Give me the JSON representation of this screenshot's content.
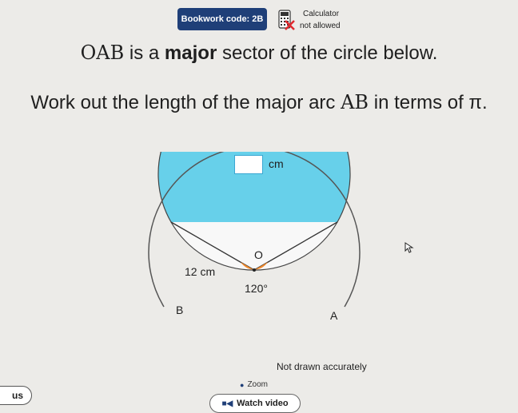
{
  "header": {
    "bookwork_label": "Bookwork code: 2B",
    "calculator_line1": "Calculator",
    "calculator_line2": "not allowed"
  },
  "question": {
    "line1_math": "OAB",
    "line1_part1": " is a ",
    "line1_bold": "major",
    "line1_part2": " sector of the circle below.",
    "line2_part1": "Work out the length of the major arc ",
    "line2_math": "AB",
    "line2_part2": " in terms of π."
  },
  "diagram": {
    "answer_unit": "cm",
    "radius_label": "12 cm",
    "angle_label": "120°",
    "label_O": "O",
    "label_A": "A",
    "label_B": "B",
    "note": "Not drawn accurately"
  },
  "controls": {
    "zoom_label": "Zoom",
    "left_button_label": "us",
    "watch_video_label": "Watch video"
  },
  "colors": {
    "sector_fill": "#67d0ea",
    "angle_fill": "#f08a2e",
    "bookwork_bg": "#1f3f78",
    "answer_box_border": "#3aa7d2"
  }
}
